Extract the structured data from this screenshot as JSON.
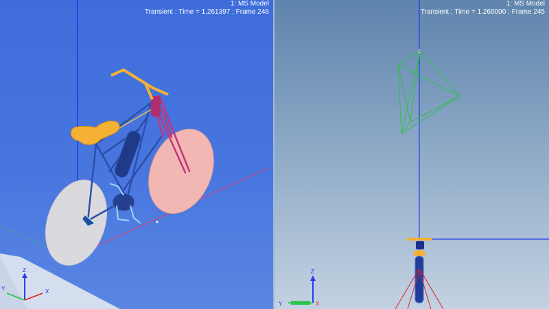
{
  "viewports": {
    "left": {
      "model_label": "1: MS Model",
      "status": "Transient : Time = 1.261397 : Frame 246",
      "triad": {
        "x": "X",
        "y": "Y",
        "z": "Z"
      }
    },
    "right": {
      "model_label": "1: MS Model",
      "status": "Transient : Time = 1.260000 : Frame 245",
      "triad": {
        "x": "X",
        "y": "Y",
        "z": "Z"
      }
    }
  },
  "colors": {
    "left_background": "#4572dd",
    "right_background_top": "#5f84ad",
    "right_background_bottom": "#c3d2e2",
    "rear_wheel": "#d9d9de",
    "front_wheel": "#f2b7b2",
    "saddle": "#f5b133",
    "handlebar": "#f5b133",
    "frame": "#2c4ea8",
    "fork": "#c2357c",
    "ground_line": "#e0406a",
    "axis_blue": "#1e3cf0",
    "axis_green": "#20c040",
    "axis_red": "#e02020",
    "wireframe_green": "#2fbf4a"
  },
  "icons": {
    "triad": "coordinate-triad-icon"
  }
}
